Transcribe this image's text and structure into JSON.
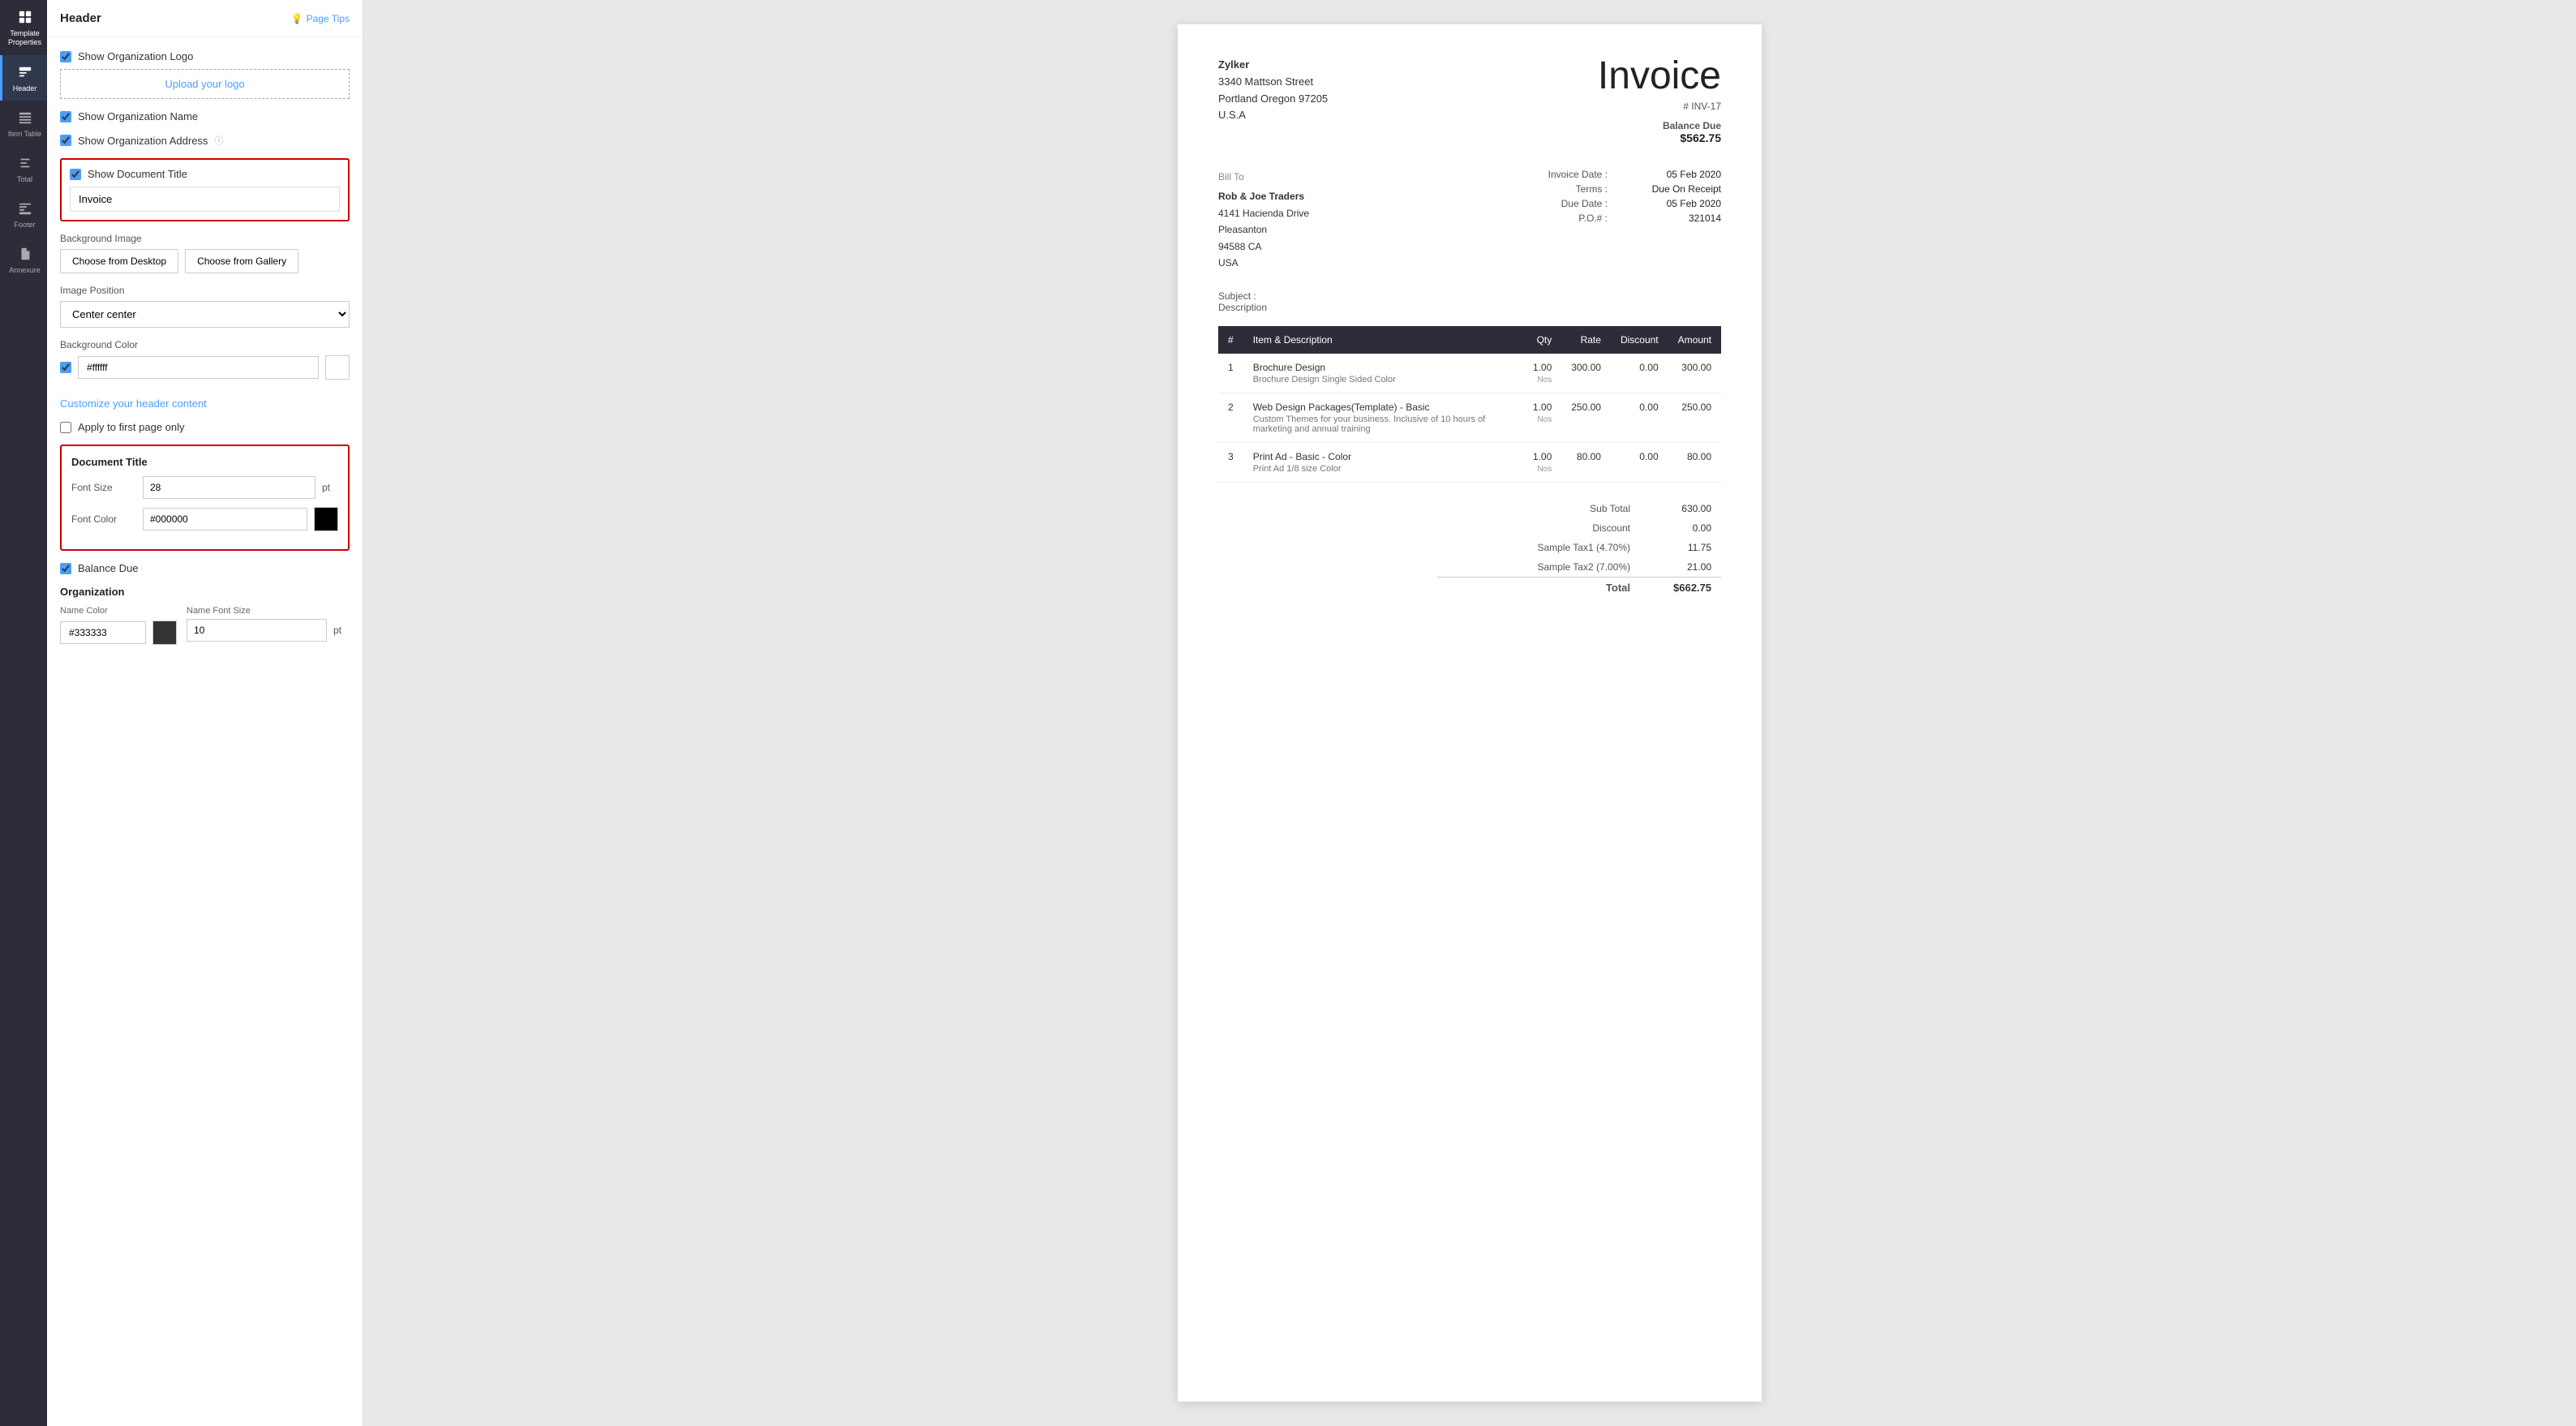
{
  "sidebar": {
    "items": [
      {
        "id": "template-properties",
        "label": "Template Properties",
        "active": false
      },
      {
        "id": "header",
        "label": "Header",
        "active": true
      },
      {
        "id": "item-table",
        "label": "Item Table",
        "active": false
      },
      {
        "id": "total",
        "label": "Total",
        "active": false
      },
      {
        "id": "footer",
        "label": "Footer",
        "active": false
      },
      {
        "id": "annexure",
        "label": "Annexure",
        "active": false
      }
    ]
  },
  "panel": {
    "title": "Header",
    "page_tips_label": "Page Tips",
    "show_org_logo_label": "Show Organization Logo",
    "upload_logo_label": "Upload your logo",
    "show_org_name_label": "Show Organization Name",
    "show_org_address_label": "Show Organization Address",
    "show_doc_title_label": "Show Document Title",
    "doc_title_value": "Invoice",
    "bg_image_label": "Background Image",
    "choose_desktop_label": "Choose from Desktop",
    "choose_gallery_label": "Choose from Gallery",
    "image_position_label": "Image Position",
    "image_position_value": "Center center",
    "bg_color_label": "Background Color",
    "bg_color_hex": "#ffffff",
    "customize_header_label": "Customize your header content",
    "apply_first_page_label": "Apply to first page only",
    "doc_title_card": {
      "title": "Document Title",
      "font_size_label": "Font Size",
      "font_size_value": "28",
      "font_size_unit": "pt",
      "font_color_label": "Font Color",
      "font_color_value": "#000000"
    },
    "balance_due_label": "Balance Due",
    "org_section": {
      "title": "Organization",
      "name_color_label": "Name Color",
      "name_color_value": "#333333",
      "name_font_size_label": "Name Font Size",
      "name_font_size_value": "10",
      "name_font_size_unit": "pt"
    }
  },
  "invoice": {
    "company": {
      "name": "Zylker",
      "address1": "3340  Mattson Street",
      "address2": "Portland Oregon 97205",
      "country": "U.S.A"
    },
    "title": "Invoice",
    "number_label": "# INV-17",
    "balance_due_label": "Balance Due",
    "balance_due_amount": "$562.75",
    "bill_to_label": "Bill To",
    "client": {
      "name": "Rob & Joe Traders",
      "address1": "4141 Hacienda Drive",
      "city": "Pleasanton",
      "zip_state": "94588 CA",
      "country": "USA"
    },
    "meta": [
      {
        "key": "Invoice Date :",
        "value": "05 Feb 2020"
      },
      {
        "key": "Terms :",
        "value": "Due On Receipt"
      },
      {
        "key": "Due Date :",
        "value": "05 Feb 2020"
      },
      {
        "key": "P.O.# :",
        "value": "321014"
      }
    ],
    "subject_label": "Subject :",
    "description_label": "Description",
    "table_headers": [
      "#",
      "Item & Description",
      "Qty",
      "Rate",
      "Discount",
      "Amount"
    ],
    "items": [
      {
        "num": "1",
        "name": "Brochure Design",
        "desc": "Brochure Design Single Sided Color",
        "qty": "1.00",
        "qty_unit": "Nos",
        "rate": "300.00",
        "discount": "0.00",
        "amount": "300.00"
      },
      {
        "num": "2",
        "name": "Web Design Packages(Template) - Basic",
        "desc": "Custom Themes for your business. Inclusive of 10 hours of marketing and annual training",
        "qty": "1.00",
        "qty_unit": "Nos",
        "rate": "250.00",
        "discount": "0.00",
        "amount": "250.00"
      },
      {
        "num": "3",
        "name": "Print Ad - Basic - Color",
        "desc": "Print Ad 1/8 size Color",
        "qty": "1.00",
        "qty_unit": "Nos",
        "rate": "80.00",
        "discount": "0.00",
        "amount": "80.00"
      }
    ],
    "totals": [
      {
        "label": "Sub Total",
        "value": "630.00"
      },
      {
        "label": "Discount",
        "value": "0.00"
      },
      {
        "label": "Sample Tax1 (4.70%)",
        "value": "11.75"
      },
      {
        "label": "Sample Tax2 (7.00%)",
        "value": "21.00"
      },
      {
        "label": "Total",
        "value": "$662.75",
        "is_total": true
      }
    ]
  },
  "colors": {
    "accent": "#4a9eff",
    "nav_bg": "#2d2d3a",
    "highlight_border": "#cc0000",
    "table_header_bg": "#2d2d3a"
  }
}
